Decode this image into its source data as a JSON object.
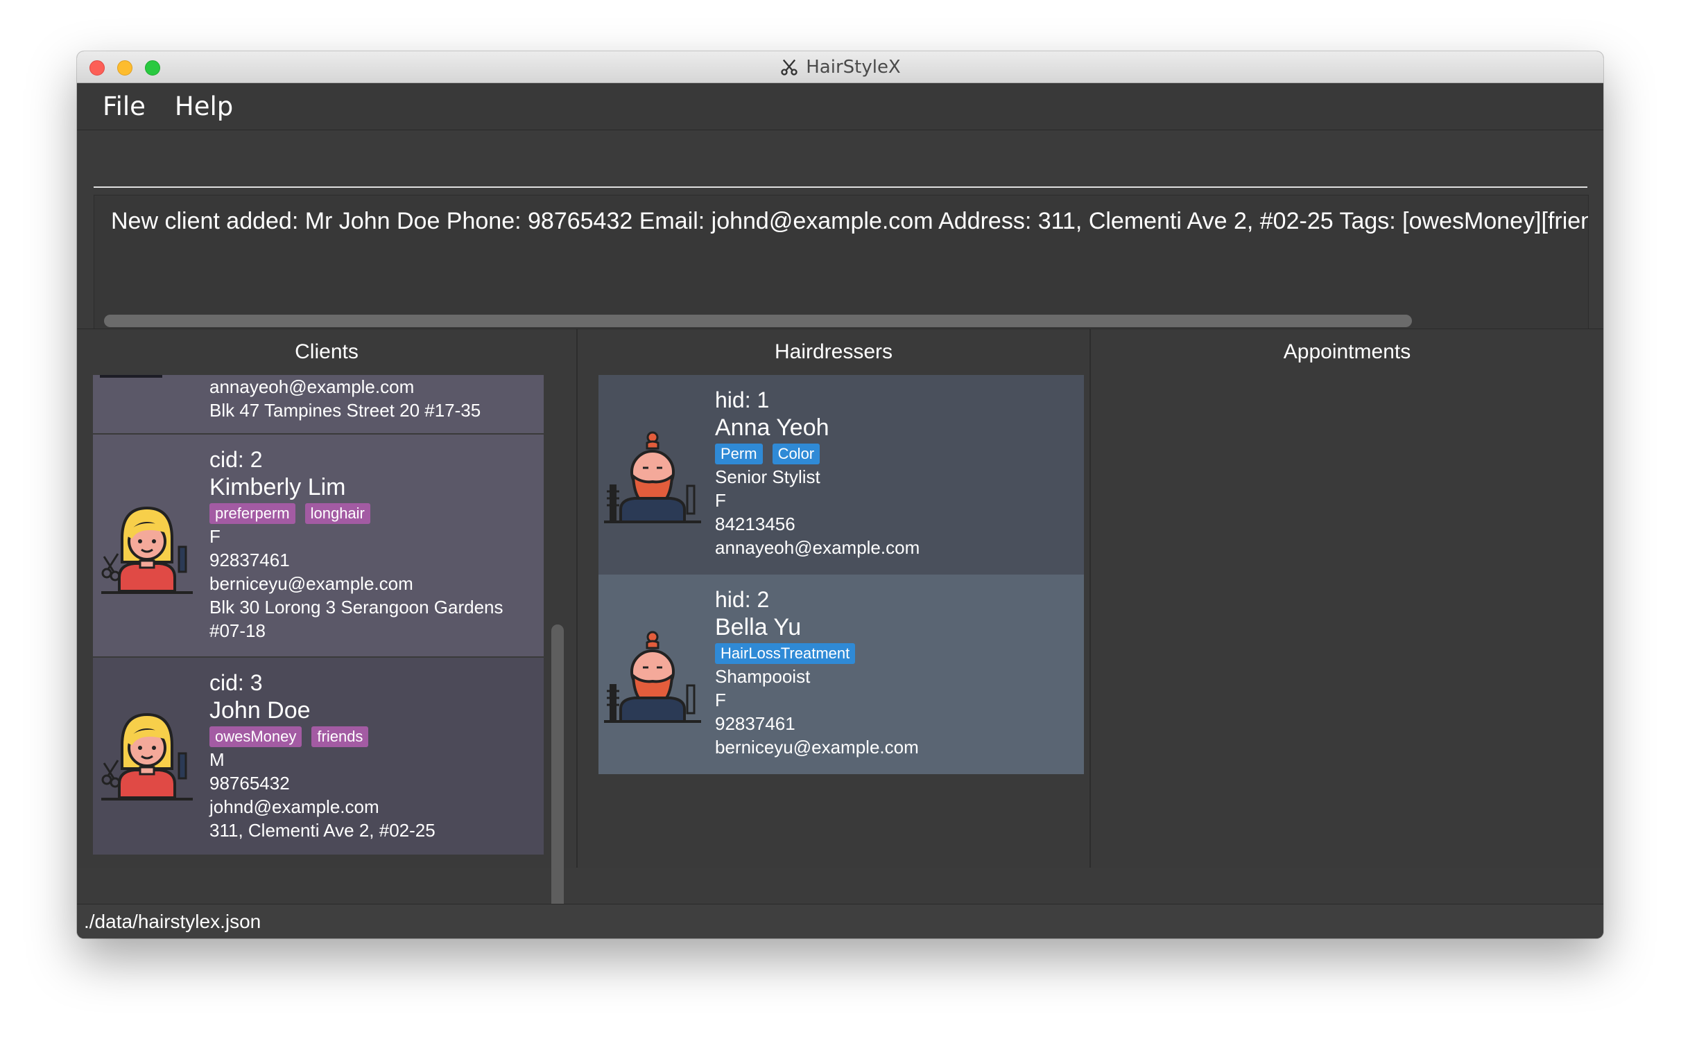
{
  "window": {
    "title": "HairStyleX",
    "title_icon": "scissors-icon"
  },
  "menu": {
    "items": [
      {
        "label": "File"
      },
      {
        "label": "Help"
      }
    ]
  },
  "command": {
    "value": "",
    "placeholder": ""
  },
  "result": {
    "text": "New client added: Mr John Doe Phone: 98765432 Email: johnd@example.com Address: 311, Clementi Ave 2, #02-25 Tags: [owesMoney][friends]"
  },
  "panels": {
    "clients_title": "Clients",
    "hairdressers_title": "Hairdressers",
    "appointments_title": "Appointments"
  },
  "clients": [
    {
      "email": "annayeoh@example.com",
      "address": "Blk 47 Tampines Street 20 #17-35"
    },
    {
      "id": "cid: 2",
      "name": "Kimberly Lim",
      "tags": [
        "preferperm",
        "longhair"
      ],
      "gender": "F",
      "phone": "92837461",
      "email": "berniceyu@example.com",
      "address": "Blk 30 Lorong 3 Serangoon Gardens",
      "address2": "#07-18"
    },
    {
      "id": "cid: 3",
      "name": "John Doe",
      "tags": [
        "owesMoney",
        "friends"
      ],
      "gender": "M",
      "phone": "98765432",
      "email": "johnd@example.com",
      "address": "311, Clementi Ave 2, #02-25"
    }
  ],
  "hairdressers": [
    {
      "id": "hid: 1",
      "name": "Anna Yeoh",
      "tags": [
        "Perm",
        "Color"
      ],
      "title": "Senior Stylist",
      "gender": "F",
      "phone": "84213456",
      "email": "annayeoh@example.com"
    },
    {
      "id": "hid: 2",
      "name": "Bella Yu",
      "tags": [
        "HairLossTreatment"
      ],
      "title": "Shampooist",
      "gender": "F",
      "phone": "92837461",
      "email": "berniceyu@example.com"
    }
  ],
  "status": {
    "path": "./data/hairstylex.json"
  },
  "colors": {
    "client_tag": "#a35ba3",
    "hairdresser_tag": "#2f8ad6",
    "client_card_a": "#5b5868",
    "client_card_b": "#4c4a58",
    "hair_card_a": "#4a505c",
    "hair_card_b": "#5a6573"
  }
}
